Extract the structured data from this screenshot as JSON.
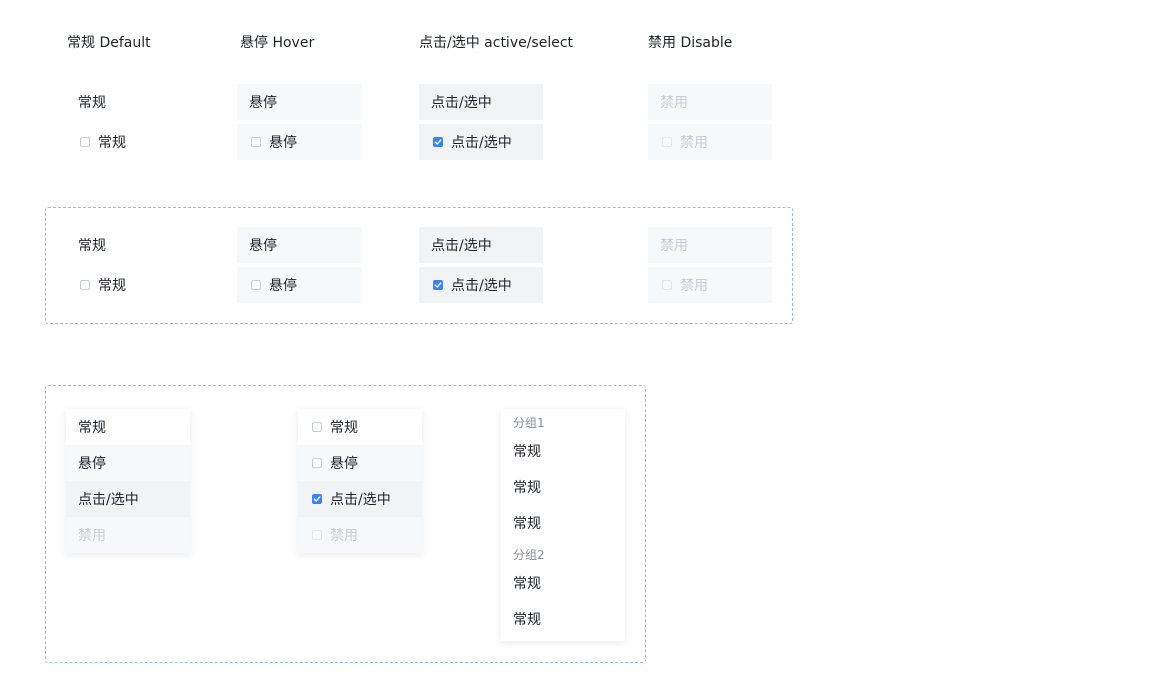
{
  "headers": {
    "default": "常规 Default",
    "hover": "悬停 Hover",
    "active": "点击/选中 active/select",
    "disabled": "禁用 Disable"
  },
  "labels": {
    "normal": "常规",
    "hover": "悬停",
    "active": "点击/选中",
    "disabled": "禁用"
  },
  "groups": {
    "group1_title": "分组1",
    "group1_items": [
      "常规",
      "常规",
      "常规"
    ],
    "group2_title": "分组2",
    "group2_items": [
      "常规",
      "常规"
    ]
  },
  "colors": {
    "accent": "#3b82f6",
    "dashed_border": "#8cc0ee",
    "hover_bg": "#f7f8fa",
    "active_bg": "#f2f3f5",
    "disabled_text": "#c9cdd4"
  },
  "icons": {
    "checkbox": "checkbox-icon",
    "checkmark": "checkmark-icon"
  }
}
